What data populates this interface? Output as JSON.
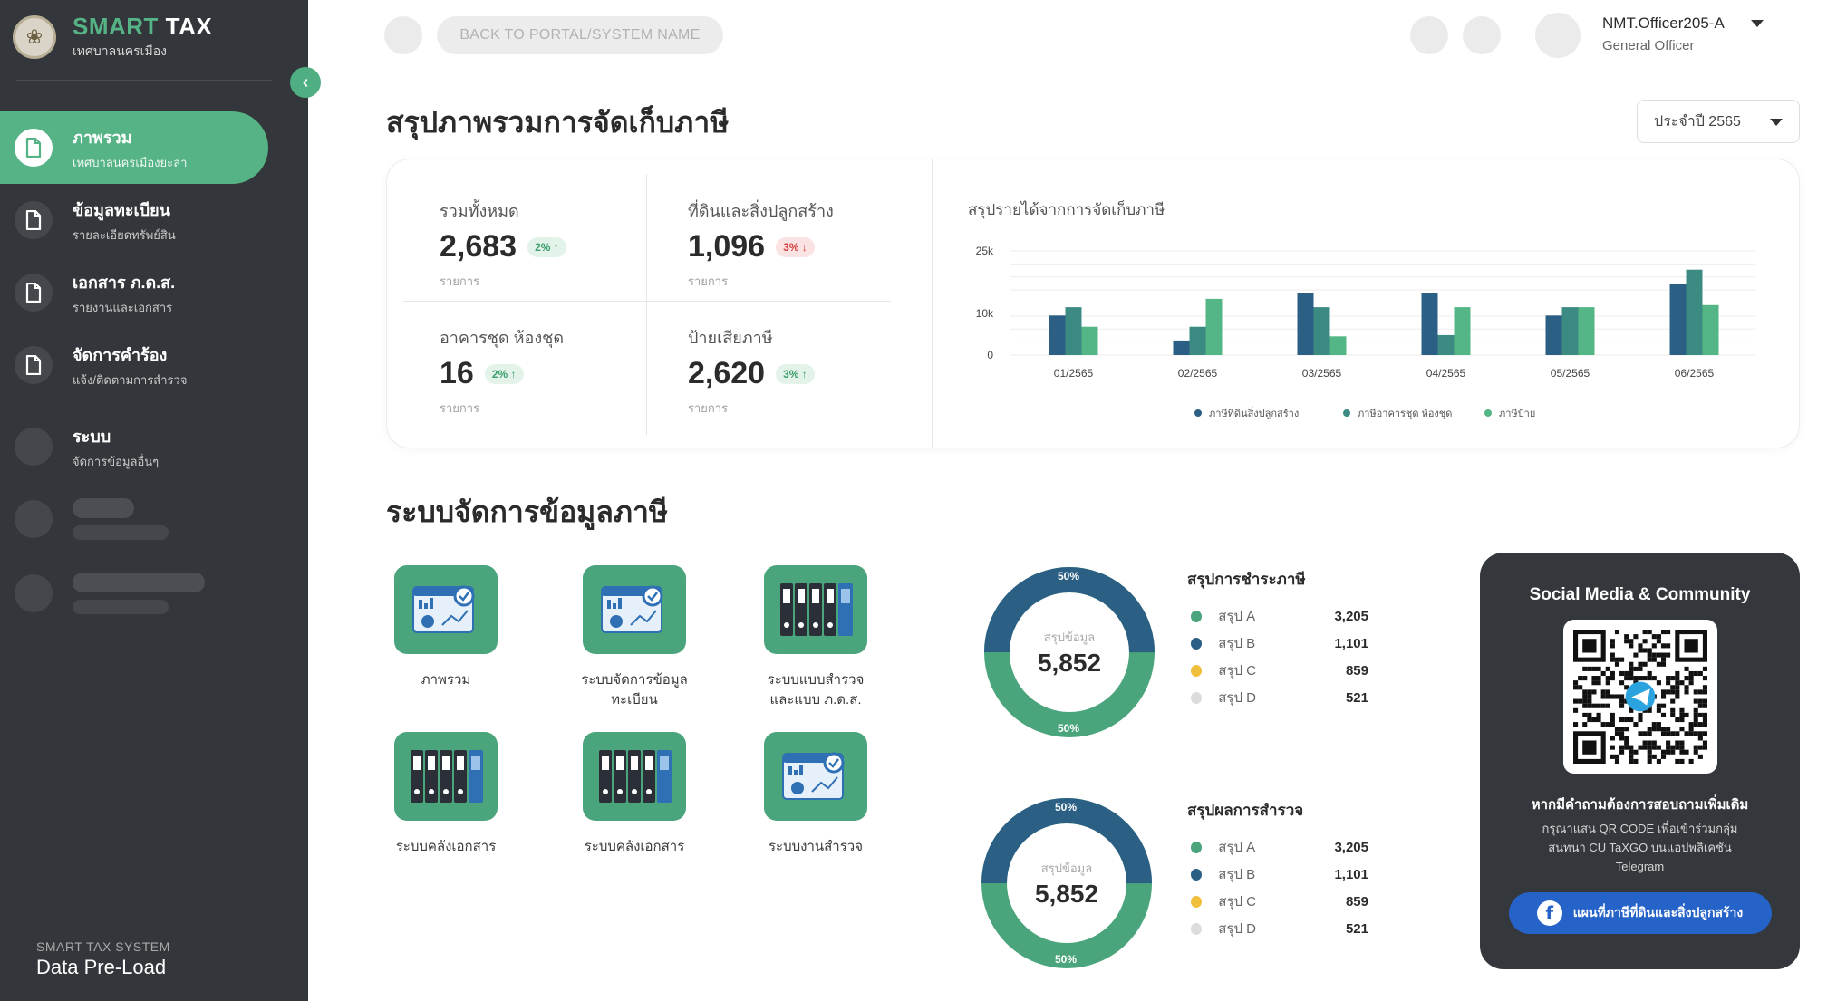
{
  "brand": {
    "title_a": "SMART",
    "title_b": " TAX",
    "subtitle": "เทศบาลนครเมือง"
  },
  "sidebar": {
    "items": [
      {
        "label": "ภาพรวม",
        "sub": "เทศบาลนครเมืองยะลา",
        "active": true,
        "icon": "file-icon"
      },
      {
        "label": "ข้อมูลทะเบียน",
        "sub": "รายละเอียดทรัพย์สิน",
        "icon": "file-icon"
      },
      {
        "label": "เอกสาร ภ.ด.ส.",
        "sub": "รายงานและเอกสาร",
        "icon": "file-icon"
      },
      {
        "label": "จัดการคำร้อง",
        "sub": "แจ้ง/ติดตามการสำรวจ",
        "icon": "file-icon"
      },
      {
        "label": "ระบบ",
        "sub": "จัดการข้อมูลอื่นๆ",
        "icon": "placeholder-circle"
      }
    ],
    "footer_sub": "SMART TAX SYSTEM",
    "footer_main": "Data Pre-Load"
  },
  "topbar": {
    "back_label": "BACK TO PORTAL/SYSTEM NAME",
    "user_name": "NMT.Officer205-A",
    "user_role": "General Officer"
  },
  "overview": {
    "title": "สรุปภาพรวมการจัดเก็บภาษี",
    "year_select": "ประจำปี 2565",
    "stats": [
      {
        "label": "รวมทั้งหมด",
        "value": "2,683",
        "change": "2%",
        "trend": "up",
        "unit": "รายการ"
      },
      {
        "label": "ที่ดินและสิ่งปลูกสร้าง",
        "value": "1,096",
        "change": "3%",
        "trend": "down",
        "unit": "รายการ"
      },
      {
        "label": "อาคารชุด ห้องชุด",
        "value": "16",
        "change": "2%",
        "trend": "up",
        "unit": "รายการ"
      },
      {
        "label": "ป้ายเสียภาษี",
        "value": "2,620",
        "change": "3%",
        "trend": "up",
        "unit": "รายการ"
      }
    ]
  },
  "chart_data": {
    "type": "bar",
    "title": "สรุปรายได้จากการจัดเก็บภาษี",
    "categories": [
      "01/2565",
      "02/2565",
      "03/2565",
      "04/2565",
      "05/2565",
      "06/2565"
    ],
    "y_ticks": [
      "0",
      "10k",
      "25k"
    ],
    "ylim": [
      0,
      25000
    ],
    "grid": true,
    "legend_position": "bottom",
    "colors": [
      "#2c5f84",
      "#3b8b83",
      "#54b686"
    ],
    "series": [
      {
        "name": "ภาษีที่ดินสิ่งปลูกสร้าง",
        "values": [
          9500,
          3500,
          15000,
          15000,
          9500,
          17000
        ]
      },
      {
        "name": "ภาษีอาคารชุด ห้องชุด",
        "values": [
          11500,
          6800,
          11500,
          4800,
          11500,
          20500
        ]
      },
      {
        "name": "ภาษีป้าย",
        "values": [
          6800,
          13500,
          4500,
          11500,
          11500,
          12000
        ]
      }
    ]
  },
  "management": {
    "title": "ระบบจัดการข้อมูลภาษี",
    "tiles": [
      {
        "label": "ภาพรวม",
        "icon": "dashboard-chart-icon"
      },
      {
        "label": "ระบบจัดการข้อมูล\nทะเบียน",
        "icon": "dashboard-chart-icon"
      },
      {
        "label": "ระบบแบบสำรวจ\nและแบบ ภ.ด.ส.",
        "icon": "binders-icon"
      },
      {
        "label": "ระบบคลังเอกสาร",
        "icon": "binders-icon"
      },
      {
        "label": "ระบบคลังเอกสาร",
        "icon": "binders-icon"
      },
      {
        "label": "ระบบงานสำรวจ",
        "icon": "dashboard-chart-icon"
      }
    ]
  },
  "donuts": [
    {
      "center_label": "สรุปข้อมูล",
      "total": "5,852",
      "top_pct": "50%",
      "bottom_pct": "50%",
      "title": "สรุปการชำระภาษี",
      "items": [
        {
          "name": "สรุป A",
          "value": "3,205",
          "color": "#4aa57c"
        },
        {
          "name": "สรุป B",
          "value": "1,101",
          "color": "#2c5f84"
        },
        {
          "name": "สรุป C",
          "value": "859",
          "color": "#f0bf3c"
        },
        {
          "name": "สรุป D",
          "value": "521",
          "color": "#dcdcdc"
        }
      ]
    },
    {
      "center_label": "สรุปข้อมูล",
      "total": "5,852",
      "top_pct": "50%",
      "bottom_pct": "50%",
      "title": "สรุปผลการสำรวจ",
      "items": [
        {
          "name": "สรุป A",
          "value": "3,205",
          "color": "#4aa57c"
        },
        {
          "name": "สรุป B",
          "value": "1,101",
          "color": "#2c5f84"
        },
        {
          "name": "สรุป C",
          "value": "859",
          "color": "#f0bf3c"
        },
        {
          "name": "สรุป D",
          "value": "521",
          "color": "#dcdcdc"
        }
      ]
    }
  ],
  "social": {
    "title": "Social Media & Community",
    "question": "หากมีคำถามต้องการสอบถามเพิ่มเติม",
    "desc_1": "กรุณาแสน QR CODE เพื่อเข้าร่วมกลุ่ม",
    "desc_2": "สนทนา CU TaXGO บนแอปพลิเคชัน",
    "desc_3": "Telegram",
    "button_label": "แผนที่ภาษีที่ดินและสิ่งปลูกสร้าง"
  }
}
